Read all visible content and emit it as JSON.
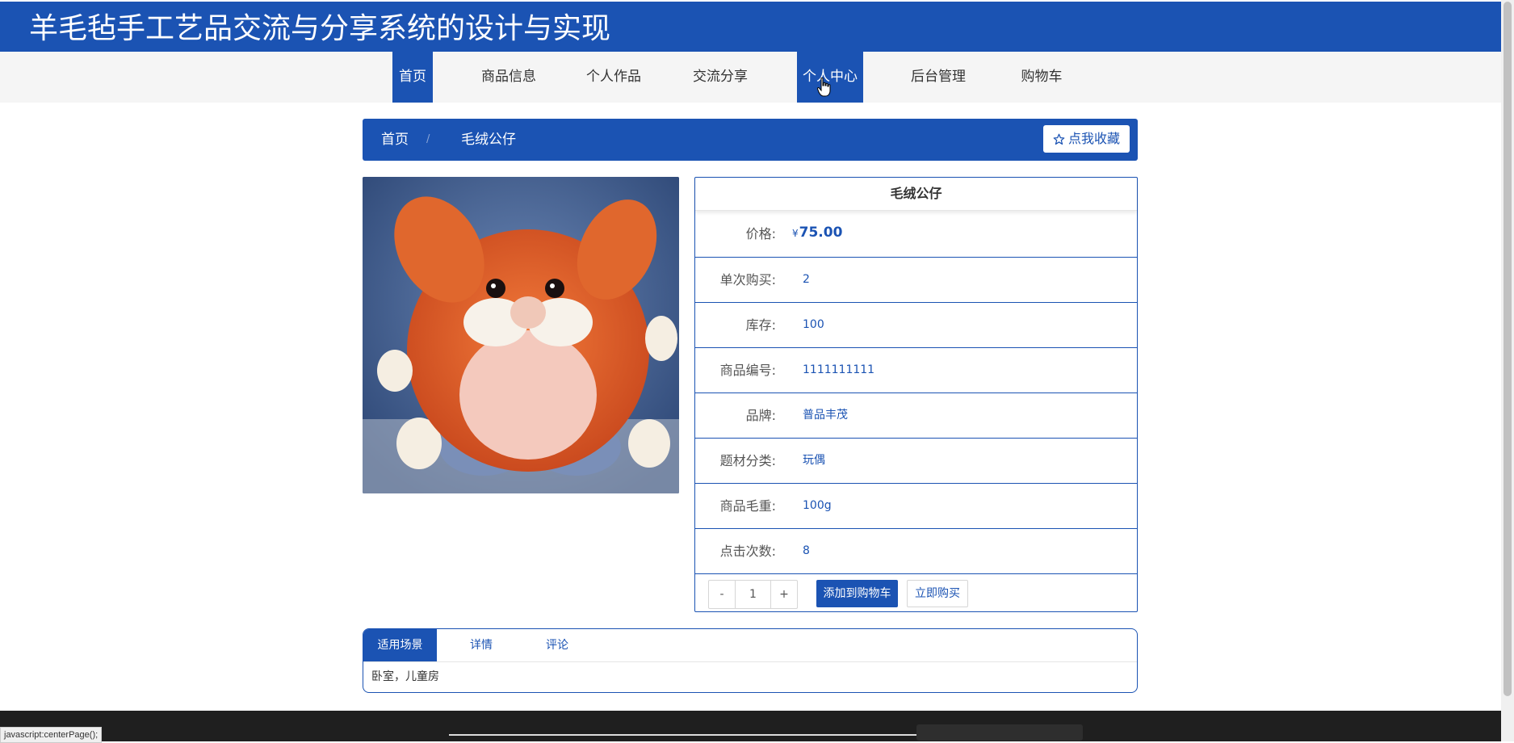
{
  "header": {
    "title": "羊毛毡手工艺品交流与分享系统的设计与实现"
  },
  "nav": {
    "items": [
      {
        "label": "首页"
      },
      {
        "label": "商品信息"
      },
      {
        "label": "个人作品"
      },
      {
        "label": "交流分享"
      },
      {
        "label": "个人中心"
      },
      {
        "label": "后台管理"
      },
      {
        "label": "购物车"
      }
    ]
  },
  "breadcrumb": {
    "home": "首页",
    "separator": "/",
    "current": "毛绒公仔",
    "favorite_label": "点我收藏"
  },
  "product": {
    "name": "毛绒公仔",
    "price_symbol": "¥",
    "price": "75.00",
    "labels": {
      "price": "价格:",
      "single_purchase": "单次购买:",
      "stock": "库存:",
      "code": "商品编号:",
      "brand": "品牌:",
      "category": "题材分类:",
      "weight": "商品毛重:",
      "clicks": "点击次数:"
    },
    "values": {
      "single_purchase": "2",
      "stock": "100",
      "code": "1111111111",
      "brand": "普品丰茂",
      "category": "玩偶",
      "weight": "100g",
      "clicks": "8"
    },
    "quantity": "1",
    "minus": "-",
    "plus": "+",
    "add_to_cart": "添加到购物车",
    "buy_now": "立即购买"
  },
  "tabs": {
    "items": [
      {
        "label": "适用场景"
      },
      {
        "label": "详情"
      },
      {
        "label": "评论"
      }
    ],
    "active_content": "卧室，儿童房"
  },
  "status_bar": {
    "url": "javascript:centerPage();"
  },
  "colors": {
    "primary": "#1b53b3",
    "nav_bg": "#f5f5f5",
    "footer_bg": "#1f1f1f"
  }
}
